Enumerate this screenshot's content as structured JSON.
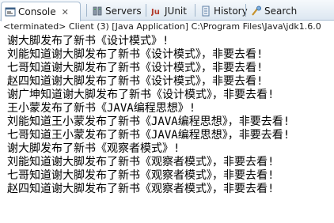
{
  "tabs": [
    {
      "label": "Console",
      "close": "✕",
      "icon": "console-icon"
    },
    {
      "label": "Servers",
      "icon": "servers-icon"
    },
    {
      "label": "JUnit",
      "icon": "junit-icon"
    },
    {
      "label": "History",
      "icon": "history-icon"
    },
    {
      "label": "Search",
      "icon": "search-icon"
    }
  ],
  "status": "<terminated> Client (3) [Java Application] C:\\Program Files\\Java\\jdk1.6.0",
  "console_lines": [
    "谢大脚发布了新书《设计模式》!",
    "刘能知道谢大脚发布了新书《设计模式》，非要去看!",
    "七哥知道谢大脚发布了新书《设计模式》，非要去看!",
    "赵四知道谢大脚发布了新书《设计模式》，非要去看!",
    "谢广坤知道谢大脚发布了新书《设计模式》，非要去看!",
    "王小蒙发布了新书《JAVA编程思想》!",
    "刘能知道王小蒙发布了新书《JAVA编程思想》，非要去看!",
    "七哥知道王小蒙发布了新书《JAVA编程思想》，非要去看!",
    "谢大脚发布了新书《观察者模式》!",
    "刘能知道谢大脚发布了新书《观察者模式》，非要去看!",
    "七哥知道谢大脚发布了新书《观察者模式》，非要去看!",
    "赵四知道谢大脚发布了新书《观察者模式》，非要去看!"
  ],
  "colors": {
    "tab_border": "#a9bdd2",
    "text": "#000000"
  }
}
